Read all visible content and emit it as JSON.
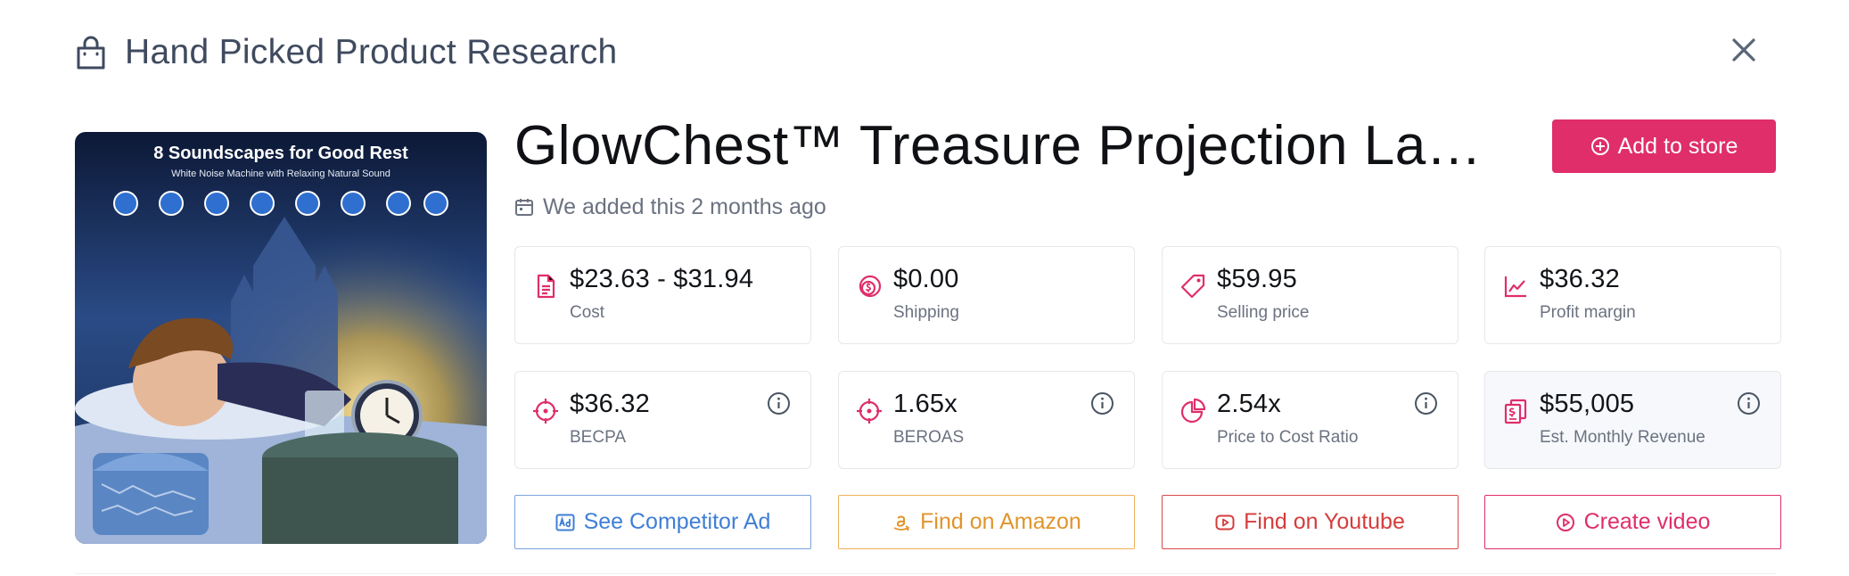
{
  "header": {
    "title": "Hand Picked Product Research"
  },
  "product": {
    "title": "GlowChest™ Treasure Projection Lam…",
    "added_text": "We added this 2 months ago",
    "image": {
      "heading": "8 Soundscapes for Good Rest",
      "subheading": "White Noise Machine with Relaxing Natural Sound"
    }
  },
  "actions": {
    "add_to_store": "Add to store"
  },
  "metrics": [
    {
      "value": "$23.63 - $31.94",
      "label": "Cost",
      "icon": "document-icon"
    },
    {
      "value": "$0.00",
      "label": "Shipping",
      "icon": "coins-icon"
    },
    {
      "value": "$59.95",
      "label": "Selling price",
      "icon": "tag-icon"
    },
    {
      "value": "$36.32",
      "label": "Profit margin",
      "icon": "trend-chart-icon"
    },
    {
      "value": "$36.32",
      "label": "BECPA",
      "icon": "crosshair-icon",
      "info": true
    },
    {
      "value": "1.65x",
      "label": "BEROAS",
      "icon": "crosshair-icon",
      "info": true
    },
    {
      "value": "2.54x",
      "label": "Price to Cost Ratio",
      "icon": "pie-chart-icon",
      "info": true
    },
    {
      "value": "$55,005",
      "label": "Est. Monthly Revenue",
      "icon": "revenue-icon",
      "info": true
    }
  ],
  "buttons": {
    "competitor_ad": "See Competitor Ad",
    "amazon": "Find on Amazon",
    "youtube": "Find on Youtube",
    "create_video": "Create video"
  },
  "colors": {
    "accent": "#df2e6a",
    "competitor": "#3f7fd5",
    "amazon": "#e0952c",
    "youtube": "#d63c3c"
  }
}
